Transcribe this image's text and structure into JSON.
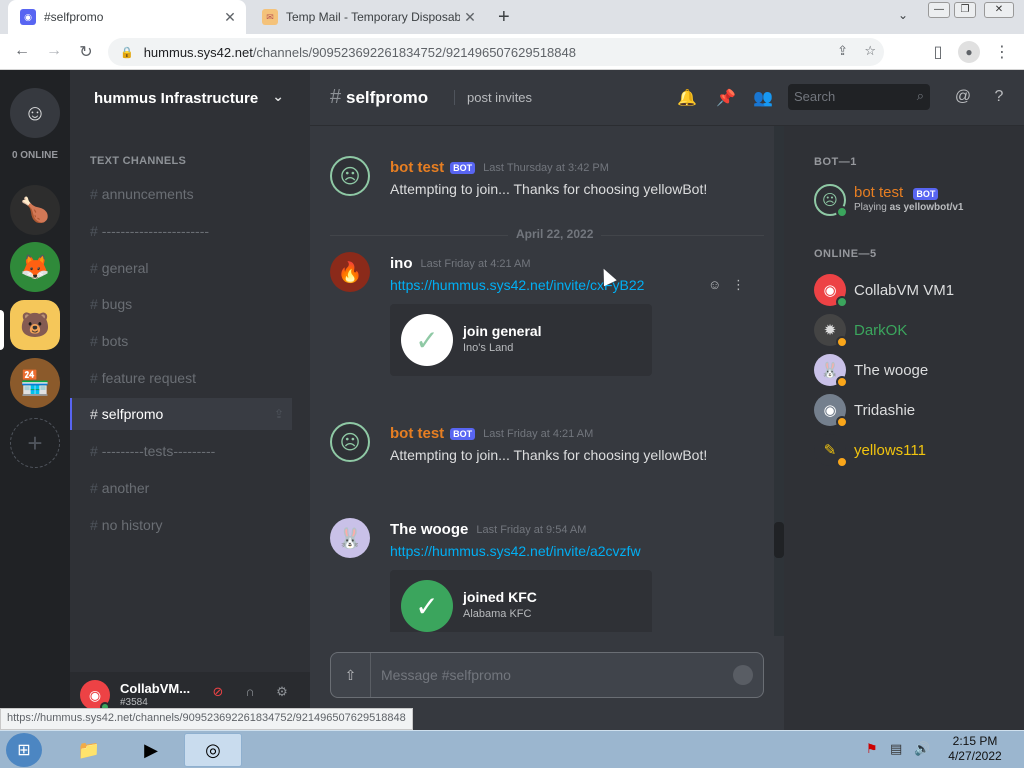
{
  "browser": {
    "tabs": [
      {
        "title": "#selfpromo",
        "active": true
      },
      {
        "title": "Temp Mail - Temporary Disposab",
        "active": false
      }
    ],
    "new_tab": "+",
    "url": {
      "host": "hummus.sys42.net",
      "path": "/channels/909523692261834752/921496507629518848"
    },
    "status_url": "https://hummus.sys42.net/channels/909523692261834752/921496507629518848"
  },
  "server": {
    "name": "hummus Infrastructure",
    "online_label": "0 ONLINE",
    "category": "TEXT CHANNELS",
    "channels": [
      {
        "name": "annuncements"
      },
      {
        "name": "-----------------------"
      },
      {
        "name": "general"
      },
      {
        "name": "bugs"
      },
      {
        "name": "bots"
      },
      {
        "name": "feature request"
      },
      {
        "name": "selfpromo",
        "active": true
      },
      {
        "name": "---------tests---------"
      },
      {
        "name": "another"
      },
      {
        "name": "no history"
      }
    ]
  },
  "user_panel": {
    "name": "CollabVM...",
    "tag": "#3584"
  },
  "chat_header": {
    "channel": "selfpromo",
    "topic": "post invites",
    "search_placeholder": "Search"
  },
  "messages": [
    {
      "author": "bot test",
      "bot_tag": "BOT",
      "timestamp": "Last Thursday at 3:42 PM",
      "text": "Attempting to join... Thanks for choosing yellowBot!"
    },
    {
      "divider": "April 22, 2022"
    },
    {
      "author": "ino",
      "timestamp": "Last Friday at 4:21 AM",
      "link": "https://hummus.sys42.net/invite/cxFyB22",
      "embed": {
        "title": "join general",
        "subtitle": "Ino's Land"
      }
    },
    {
      "author": "bot test",
      "bot_tag": "BOT",
      "timestamp": "Last Friday at 4:21 AM",
      "text": "Attempting to join... Thanks for choosing yellowBot!"
    },
    {
      "author": "The wooge",
      "timestamp": "Last Friday at 9:54 AM",
      "link": "https://hummus.sys42.net/invite/a2cvzfw",
      "embed": {
        "title": "joined KFC",
        "subtitle": "Alabama KFC"
      }
    }
  ],
  "composer": {
    "placeholder": "Message #selfpromo"
  },
  "members": {
    "bot_category": "BOT—1",
    "online_category": "ONLINE—5",
    "bot": {
      "name": "bot test",
      "tag": "BOT",
      "activity_prefix": "Playing ",
      "activity": "as yellowbot/v1"
    },
    "online": [
      {
        "name": "CollabVM VM1"
      },
      {
        "name": "DarkOK"
      },
      {
        "name": "The wooge"
      },
      {
        "name": "Tridashie"
      },
      {
        "name": "yellows111"
      }
    ]
  },
  "taskbar": {
    "time": "2:15 PM",
    "date": "4/27/2022"
  },
  "colors": {
    "bot_name": "#e67e22",
    "darkok_name": "#3ba55d",
    "yellows_name": "#f1c40f",
    "online": "#3ba55d",
    "idle": "#faa61a",
    "link": "#00aff4",
    "blurple": "#5865f2"
  }
}
